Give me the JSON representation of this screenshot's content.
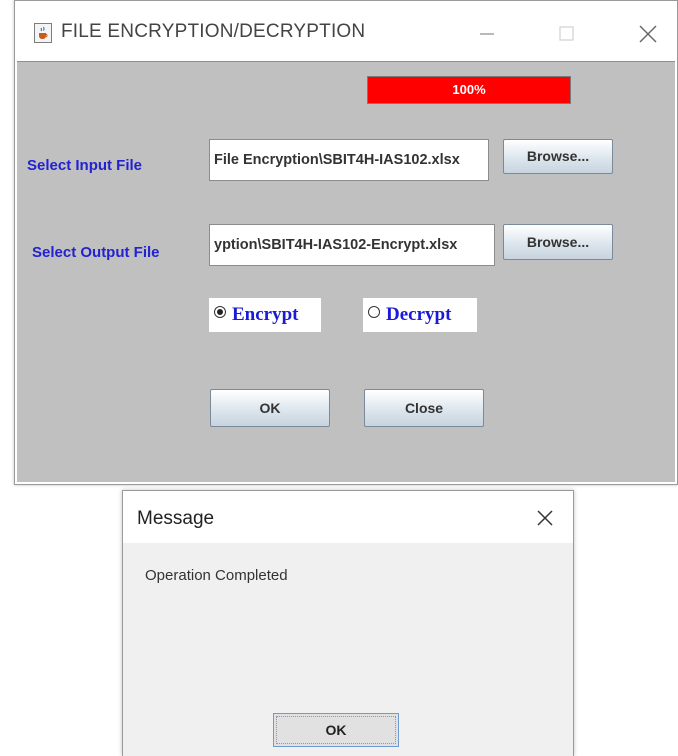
{
  "main_window": {
    "title": "FILE ENCRYPTION/DECRYPTION",
    "progress": {
      "value": 1.0,
      "label": "100%",
      "color": "#ff0000"
    },
    "input_label": "Select Input  File",
    "input_path": "File Encryption\\SBIT4H-IAS102.xlsx",
    "output_label": "Select Output File",
    "output_path": "yption\\SBIT4H-IAS102-Encrypt.xlsx",
    "browse_label": "Browse...",
    "radio_encrypt": "Encrypt",
    "radio_decrypt": "Decrypt",
    "selected_mode": "Encrypt",
    "ok_label": "OK",
    "close_label": "Close",
    "label_color": "#2222d0",
    "panel_color": "#c0c0c0"
  },
  "message_dialog": {
    "title": "Message",
    "text": "Operation Completed",
    "ok_label": "OK"
  },
  "icons": {
    "app": "java-coffee-cup-icon",
    "minimize": "minimize-icon",
    "maximize": "maximize-icon",
    "close": "close-icon"
  }
}
